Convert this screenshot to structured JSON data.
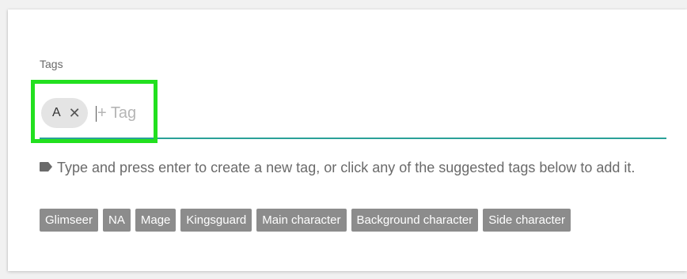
{
  "field": {
    "label": "Tags"
  },
  "chips": [
    {
      "label": "A",
      "remove_icon": "close-icon"
    }
  ],
  "input": {
    "placeholder": "+ Tag",
    "value": ""
  },
  "hint": {
    "icon": "tag-icon",
    "text": "Type and press enter to create a new tag, or click any of the suggested tags below to add it."
  },
  "suggested_tags": [
    "Glimseer",
    "NA",
    "Mage",
    "Kingsguard",
    "Main character",
    "Background character",
    "Side character"
  ],
  "colors": {
    "underline": "#2aa198",
    "highlight": "#22e01f",
    "suggest_bg": "#8c8c8c",
    "chip_bg": "#e4e4e4"
  }
}
